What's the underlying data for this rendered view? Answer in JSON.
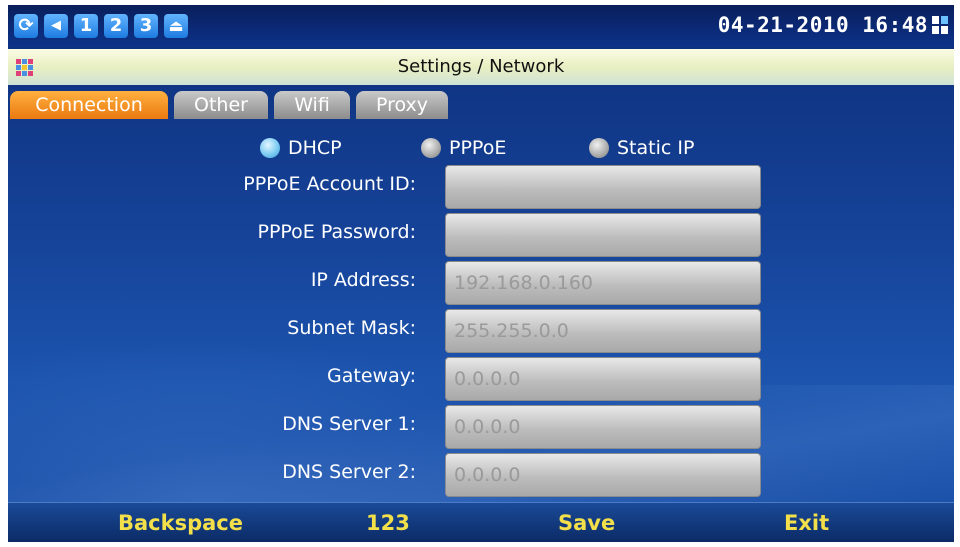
{
  "status_bar": {
    "icons": [
      {
        "name": "refresh-icon",
        "glyph": "⟳"
      },
      {
        "name": "speaker-icon",
        "glyph": "◀"
      },
      {
        "name": "account-1-icon",
        "glyph": "1"
      },
      {
        "name": "account-2-icon",
        "glyph": "2"
      },
      {
        "name": "account-3-icon",
        "glyph": "3"
      },
      {
        "name": "hook-icon",
        "glyph": "⏏"
      }
    ],
    "datetime": "04-21-2010 16:48"
  },
  "title_bar": {
    "title": "Settings / Network"
  },
  "tabs": [
    {
      "label": "Connection",
      "active": true
    },
    {
      "label": "Other",
      "active": false
    },
    {
      "label": "Wifi",
      "active": false
    },
    {
      "label": "Proxy",
      "active": false
    }
  ],
  "connection_type": {
    "options": [
      {
        "label": "DHCP",
        "selected": true
      },
      {
        "label": "PPPoE",
        "selected": false
      },
      {
        "label": "Static IP",
        "selected": false
      }
    ]
  },
  "form": {
    "fields": [
      {
        "label": "PPPoE Account ID:",
        "value": ""
      },
      {
        "label": "PPPoE Password:",
        "value": ""
      },
      {
        "label": "IP Address:",
        "value": "192.168.0.160"
      },
      {
        "label": "Subnet Mask:",
        "value": "255.255.0.0"
      },
      {
        "label": "Gateway:",
        "value": "0.0.0.0"
      },
      {
        "label": "DNS Server 1:",
        "value": "0.0.0.0"
      },
      {
        "label": "DNS Server 2:",
        "value": "0.0.0.0"
      }
    ]
  },
  "softkeys": {
    "backspace": "Backspace",
    "mode": "123",
    "save": "Save",
    "exit": "Exit"
  },
  "colors": {
    "tab_active": "#ea7a10",
    "softkey_text": "#f2df4a",
    "background": "#16449a"
  }
}
